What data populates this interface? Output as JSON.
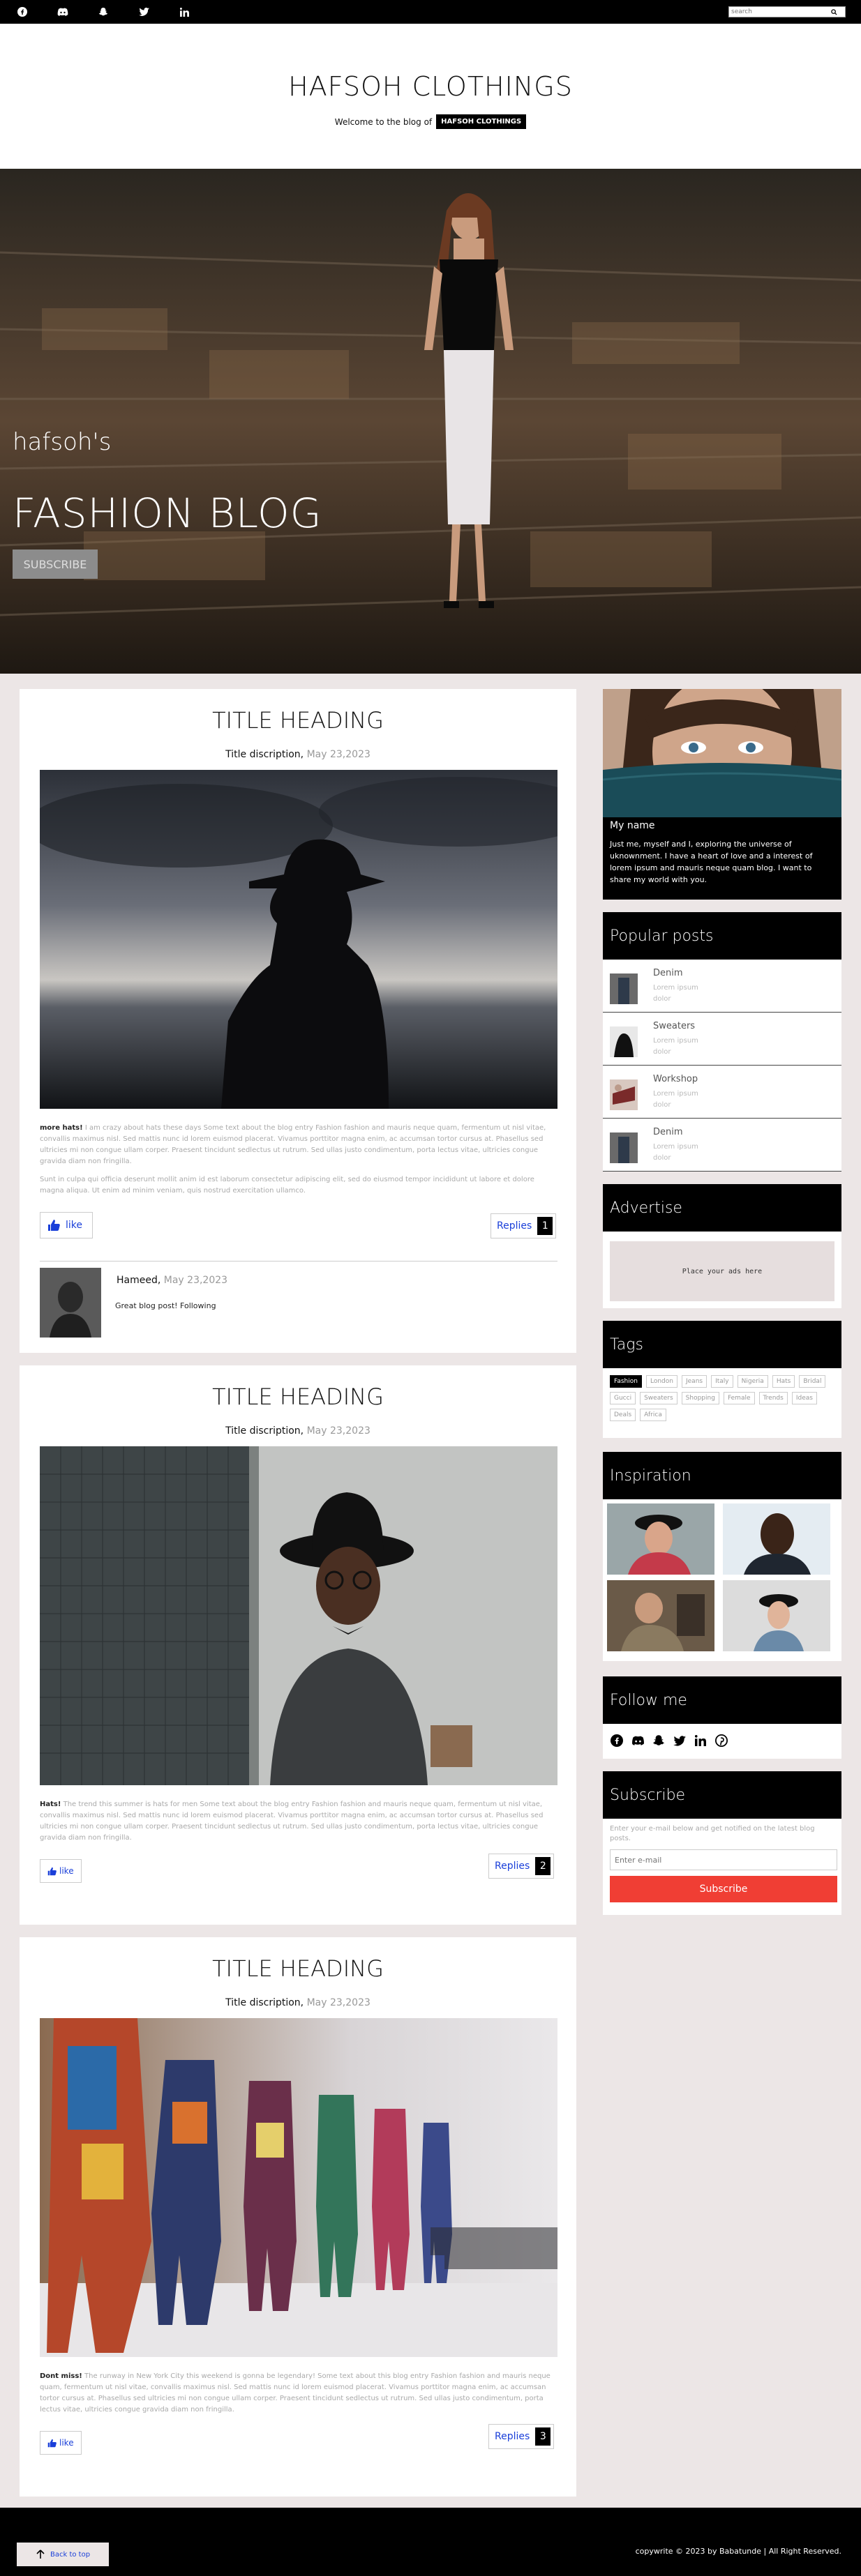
{
  "topbar": {
    "social_icons": [
      "facebook-icon",
      "discord-icon",
      "snapchat-icon",
      "twitter-icon",
      "linkedin-icon"
    ],
    "search_placeholder": "search"
  },
  "header": {
    "title": "HAFSOH CLOTHINGS",
    "welcome": "Welcome to the blog of",
    "brand_tag": "HAFSOH CLOTHINGS"
  },
  "hero": {
    "small": "hafsoh's",
    "big": "FASHION BLOG",
    "button": "SUBSCRIBE"
  },
  "posts": [
    {
      "title": "TITLE HEADING",
      "desc": "Title discription,",
      "date": "May 23,2023",
      "body_lead": "more hats!",
      "body": " I am crazy about hats these days Some text about the blog entry Fashion fashion and mauris neque quam, fermentum ut nisl vitae, convallis maximus nisl. Sed mattis nunc id lorem euismod placerat. Vivamus porttitor magna enim, ac accumsan tortor cursus at. Phasellus sed ultricies mi non congue ullam corper. Praesent tincidunt sedlectus ut rutrum. Sed ullas justo condimentum, porta lectus vitae, ultricies congue gravida diam non fringilla.",
      "body2": "Sunt in culpa qui officia deserunt mollit anim id est laborum consectetur adipiscing elit, sed do eiusmod tempor incididunt ut labore et dolore magna aliqua. Ut enim ad minim veniam, quis nostrud exercitation ullamco.",
      "like": "like",
      "replies": "Replies",
      "reply_count": "1",
      "comment": {
        "name": "Hameed,",
        "date": "May 23,2023",
        "text": "Great blog post! Following"
      }
    },
    {
      "title": "TITLE HEADING",
      "desc": "Title discription,",
      "date": "May 23,2023",
      "body_lead": "Hats!",
      "body": " The trend this summer is hats for men Some text about the blog entry Fashion fashion and mauris neque quam, fermentum ut nisl vitae, convallis maximus nisl. Sed mattis nunc id lorem euismod placerat. Vivamus porttitor magna enim, ac accumsan tortor cursus at. Phasellus sed ultricies mi non congue ullam corper. Praesent tincidunt sedlectus ut rutrum. Sed ullas justo condimentum, porta lectus vitae, ultricies congue gravida diam non fringilla.",
      "like": "like",
      "replies": "Replies",
      "reply_count": "2"
    },
    {
      "title": "TITLE HEADING",
      "desc": "Title discription,",
      "date": "May 23,2023",
      "body_lead": "Dont miss!",
      "body": " The runway in New York City this weekend is gonna be legendary! Some text about this blog entry Fashion fashion and mauris neque quam, fermentum ut nisl vitae, convallis maximus nisl. Sed mattis nunc id lorem euismod placerat. Vivamus porttitor magna enim, ac accumsan tortor cursus at. Phasellus sed ultricies mi non congue ullam corper. Praesent tincidunt sedlectus ut rutrum. Sed ullas justo condimentum, porta lectus vitae, ultricies congue gravida diam non fringilla.",
      "like": "like",
      "replies": "Replies",
      "reply_count": "3"
    }
  ],
  "sidebar": {
    "profile": {
      "name": "My name",
      "desc": "Just me, myself and I, exploring the universe of uknownment. I have a heart of love and a interest of lorem ipsum and mauris neque quam blog. I want to share my world with you."
    },
    "popular": {
      "title": "Popular posts",
      "items": [
        {
          "title": "Denim",
          "desc": "Lorem ipsum dolor"
        },
        {
          "title": "Sweaters",
          "desc": "Lorem ipsum dolor"
        },
        {
          "title": "Workshop",
          "desc": "Lorem ipsum dolor"
        },
        {
          "title": "Denim",
          "desc": "Lorem ipsum dolor"
        }
      ]
    },
    "advertise": {
      "title": "Advertise",
      "text": "Place your ads here"
    },
    "tags": {
      "title": "Tags",
      "items": [
        "Fashion",
        "London",
        "Jeans",
        "Italy",
        "Nigeria",
        "Hats",
        "Bridal",
        "Gucci",
        "Sweaters",
        "Shopping",
        "Female",
        "Trends",
        "Ideas",
        "Deals",
        "Africa"
      ]
    },
    "inspiration": {
      "title": "Inspiration"
    },
    "follow": {
      "title": "Follow me",
      "icons": [
        "facebook-icon",
        "discord-icon",
        "snapchat-icon",
        "twitter-icon",
        "linkedin-icon",
        "pinterest-icon"
      ]
    },
    "subscribe": {
      "title": "Subscribe",
      "text": "Enter your e-mail below and get notified on the latest blog posts.",
      "placeholder": "Enter e-mail",
      "button": "Subscribe"
    }
  },
  "footer": {
    "back_to_top": "Back to top",
    "copyright": "copywrite © 2023 by Babatunde | All Right Reserved."
  },
  "colors": {
    "accent": "#f03e34",
    "link": "#1a3fd9",
    "dark": "#000000"
  }
}
